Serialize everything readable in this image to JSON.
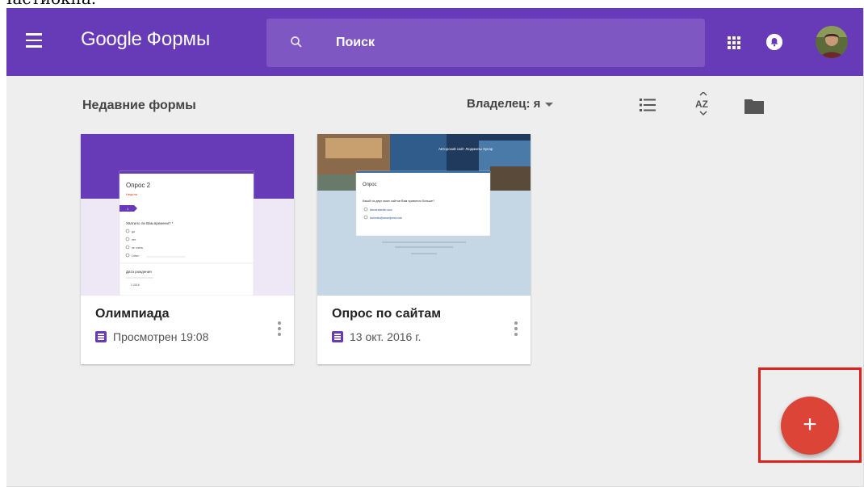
{
  "stray_caption": "Частиокна.",
  "header": {
    "brand_google": "Google",
    "brand_product": "Формы",
    "search_placeholder": "Поиск",
    "accent_color": "#673ab7"
  },
  "toolbar": {
    "section_title": "Недавние формы",
    "owner_filter": "Владелец: я"
  },
  "forms": [
    {
      "title": "Олимпиада",
      "meta": "Просмотрен 19:08",
      "thumb": {
        "form_title": "Опрос 2",
        "form_desc": "Недели",
        "section": "1",
        "question": "Хватило ли Вам времени? *",
        "options": [
          "да",
          "нет",
          "не очень",
          "Other:"
        ],
        "date_label": "Дата рождения",
        "date_value": "1 2016"
      }
    },
    {
      "title": "Опрос по сайтам",
      "meta": "13 окт. 2016 г.",
      "thumb": {
        "form_title": "Опрос",
        "question": "Какой из двух моих сайтов Вам нравится больше?",
        "options": [
          "toloverdrasher.ucoz",
          "tuchenko@wwordpress.com"
        ],
        "banner_text": "Авторский сайт Людмилы Хунэр"
      }
    }
  ],
  "fab": {
    "label": "+",
    "color": "#db4437"
  },
  "icons": [
    "menu-icon",
    "search-icon",
    "apps-icon",
    "bell-icon",
    "list-view-icon",
    "sort-az-icon",
    "folder-icon",
    "more-vert-icon",
    "form-icon"
  ]
}
